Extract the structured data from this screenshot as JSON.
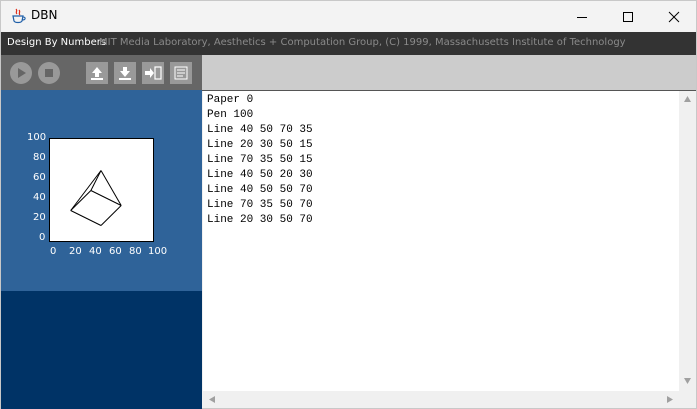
{
  "window": {
    "title": "DBN"
  },
  "header": {
    "app_name": "Design By Numbers",
    "credit": "MIT Media Laboratory, Aesthetics + Computation Group, (C) 1999, Massachusetts Institute of Technology"
  },
  "toolbar": {
    "buttons": [
      "play-icon",
      "stop-icon",
      "upload-icon",
      "download-icon",
      "export-icon",
      "print-icon"
    ]
  },
  "canvas": {
    "y_ticks": [
      "100",
      "80",
      "60",
      "40",
      "20",
      "0"
    ],
    "x_ticks": [
      "0",
      "20",
      "40",
      "60",
      "80",
      "100"
    ],
    "paper": 0,
    "pen": 100,
    "lines": [
      [
        40,
        50,
        70,
        35
      ],
      [
        20,
        30,
        50,
        15
      ],
      [
        70,
        35,
        50,
        15
      ],
      [
        40,
        50,
        20,
        30
      ],
      [
        40,
        50,
        50,
        70
      ],
      [
        70,
        35,
        50,
        70
      ],
      [
        20,
        30,
        50,
        70
      ]
    ]
  },
  "editor": {
    "lines": [
      "Paper 0",
      "Pen 100",
      "Line 40 50 70 35",
      "Line 20 30 50 15",
      "Line 70 35 50 15",
      "Line 40 50 20 30",
      "Line 40 50 50 70",
      "Line 70 35 50 70",
      "Line 20 30 50 70"
    ]
  },
  "colors": {
    "panel_blue": "#2f6399",
    "panel_navy": "#003366",
    "header_bg": "#333333",
    "toolbar_dark": "#666666",
    "toolbar_light": "#cccccc"
  }
}
